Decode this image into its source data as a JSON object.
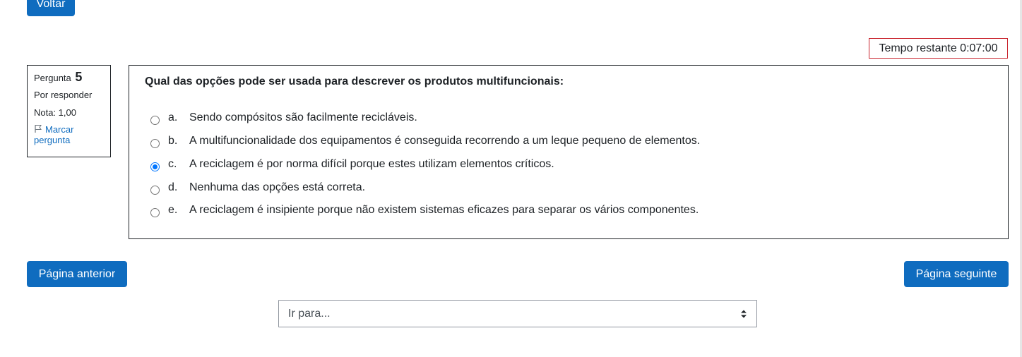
{
  "nav": {
    "back_label": "Voltar",
    "prev_label": "Página anterior",
    "next_label": "Página seguinte"
  },
  "timer": {
    "label": "Tempo restante 0:07:00"
  },
  "question_info": {
    "label": "Pergunta",
    "number": "5",
    "state": "Por responder",
    "grade": "Nota: 1,00",
    "flag_label": "Marcar pergunta"
  },
  "question": {
    "text": "Qual das opções pode ser usada para descrever os produtos multifuncionais:",
    "answers": [
      {
        "letter": "a.",
        "text": "Sendo compósitos são facilmente recicláveis.",
        "checked": false
      },
      {
        "letter": "b.",
        "text": "A multifuncionalidade dos equipamentos é conseguida recorrendo a um leque pequeno de elementos.",
        "checked": false
      },
      {
        "letter": "c.",
        "text": "A reciclagem é por norma difícil porque estes utilizam elementos críticos.",
        "checked": true
      },
      {
        "letter": "d.",
        "text": "Nenhuma das opções está correta.",
        "checked": false
      },
      {
        "letter": "e.",
        "text": "A reciclagem é insipiente porque não existem sistemas eficazes para separar os vários componentes.",
        "checked": false
      }
    ]
  },
  "jump": {
    "selected": "Ir para..."
  },
  "colors": {
    "primary": "#0f6cbf",
    "timer_border": "#c8222c",
    "radio_checked": "#0075ff"
  }
}
